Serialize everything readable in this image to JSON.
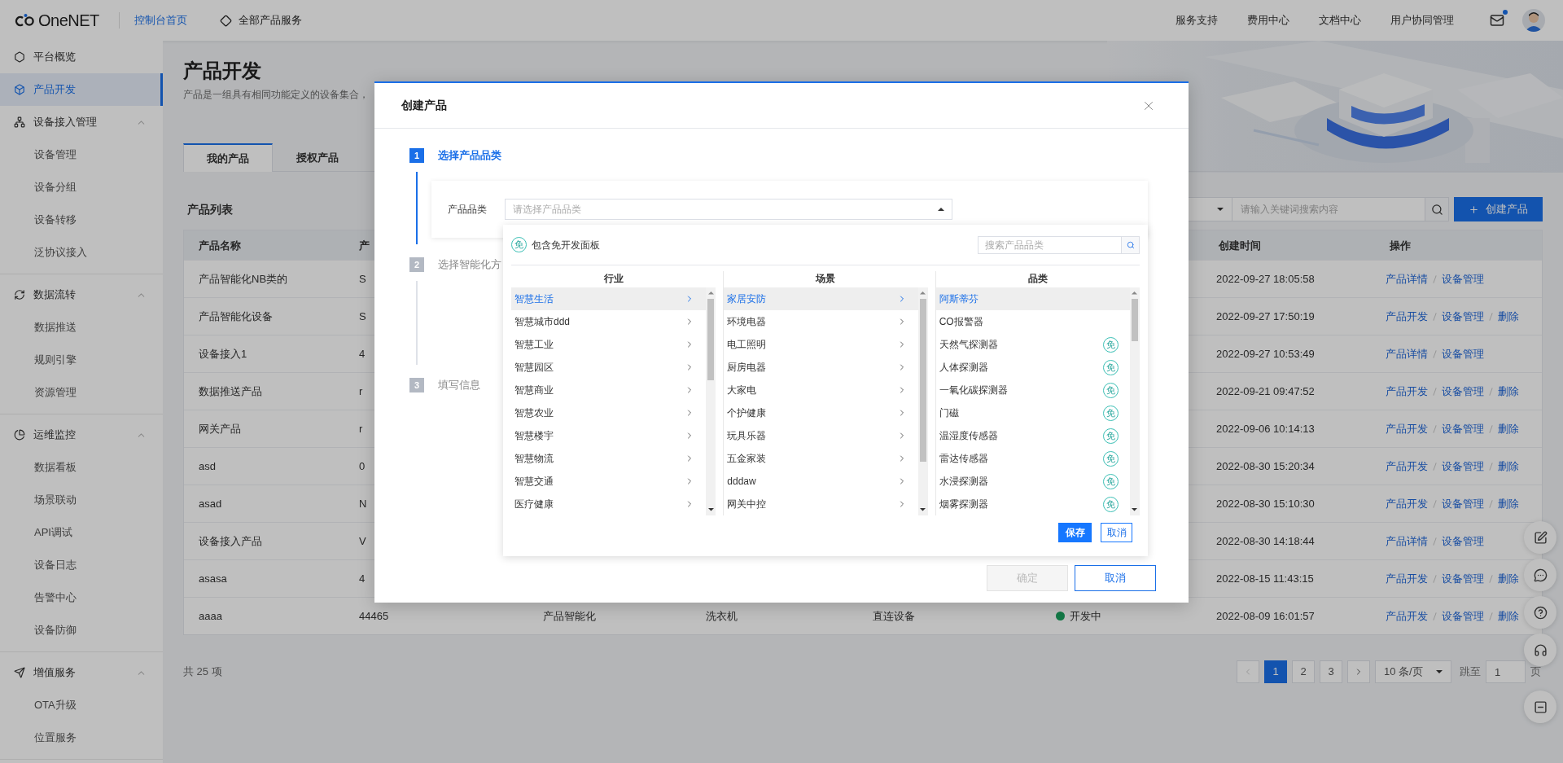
{
  "header": {
    "logo": "OneNET",
    "home_link": {
      "label": "控制台首页",
      "selected": true
    },
    "products_menu": "全部产品服务",
    "links": [
      "服务支持",
      "费用中心",
      "文档中心",
      "用户协同管理"
    ],
    "mail": {
      "unread": true
    }
  },
  "sidebar": {
    "items": [
      {
        "label": "平台概览",
        "selected": false
      },
      {
        "label": "产品开发",
        "selected": true
      },
      {
        "label": "设备接入管理",
        "expanded": true,
        "children": [
          {
            "label": "设备管理",
            "selected": false
          },
          {
            "label": "设备分组",
            "selected": false
          },
          {
            "label": "设备转移",
            "selected": false
          },
          {
            "label": "泛协议接入",
            "selected": false
          }
        ]
      },
      {
        "label": "数据流转",
        "expanded": true,
        "children": [
          {
            "label": "数据推送",
            "selected": false
          },
          {
            "label": "规则引擎",
            "selected": false
          },
          {
            "label": "资源管理",
            "selected": false
          }
        ]
      },
      {
        "label": "运维监控",
        "expanded": true,
        "children": [
          {
            "label": "数据看板",
            "selected": false
          },
          {
            "label": "场景联动",
            "selected": false
          },
          {
            "label": "API调试",
            "selected": false
          },
          {
            "label": "设备日志",
            "selected": false
          },
          {
            "label": "告警中心",
            "selected": false
          },
          {
            "label": "设备防御",
            "selected": false
          }
        ]
      },
      {
        "label": "增值服务",
        "expanded": true,
        "children": [
          {
            "label": "OTA升级",
            "selected": false
          },
          {
            "label": "位置服务",
            "selected": false
          }
        ]
      }
    ]
  },
  "page": {
    "title": "产品开发",
    "subtitle": "产品是一组具有相同功能定义的设备集合，",
    "tabs": [
      {
        "label": "我的产品",
        "selected": true
      },
      {
        "label": "授权产品",
        "selected": false
      }
    ],
    "list_title": "产品列表",
    "search": {
      "placeholder": "请输入关键词搜索内容"
    },
    "create_button": "创建产品"
  },
  "table": {
    "columns": [
      "产品名称",
      "产",
      "创建时间",
      "操作"
    ],
    "rows": [
      {
        "name": "产品智能化NB类的",
        "column_2": "S",
        "created": "2022-09-27 18:05:58",
        "actions": [
          "产品详情",
          "设备管理"
        ]
      },
      {
        "name": "产品智能化设备",
        "column_2": "S",
        "created": "2022-09-27 17:50:19",
        "actions": [
          "产品开发",
          "设备管理",
          "删除"
        ]
      },
      {
        "name": "设备接入1",
        "column_2": "4",
        "created": "2022-09-27 10:53:49",
        "actions": [
          "产品详情",
          "设备管理"
        ]
      },
      {
        "name": "数据推送产品",
        "column_2": "r",
        "created": "2022-09-21 09:47:52",
        "actions": [
          "产品开发",
          "设备管理",
          "删除"
        ]
      },
      {
        "name": "网关产品",
        "column_2": "r",
        "created": "2022-09-06 10:14:13",
        "actions": [
          "产品开发",
          "设备管理",
          "删除"
        ]
      },
      {
        "name": "asd",
        "column_2": "0",
        "created": "2022-08-30 15:20:34",
        "actions": [
          "产品开发",
          "设备管理",
          "删除"
        ]
      },
      {
        "name": "asad",
        "column_2": "N",
        "created": "2022-08-30 15:10:30",
        "actions": [
          "产品开发",
          "设备管理",
          "删除"
        ]
      },
      {
        "name": "设备接入产品",
        "column_2": "V",
        "created": "2022-08-30 14:18:44",
        "actions": [
          "产品详情",
          "设备管理"
        ]
      },
      {
        "name": "asasa",
        "column_2": "4",
        "created": "2022-08-15 11:43:15",
        "actions": [
          "产品开发",
          "设备管理",
          "删除"
        ]
      },
      {
        "name": "aaaa",
        "column_2": "44465",
        "column_3": "产品智能化",
        "column_4": "洗衣机",
        "column_5": "直连设备",
        "status": {
          "label": "开发中",
          "color": "#137947"
        },
        "created": "2022-08-09 16:01:57",
        "actions": [
          "产品开发",
          "设备管理",
          "删除"
        ]
      }
    ]
  },
  "footer": {
    "total": "共 25 项",
    "pagination": {
      "prev_disabled": true,
      "pages": [
        {
          "label": "1",
          "selected": true
        },
        {
          "label": "2",
          "selected": false
        },
        {
          "label": "3",
          "selected": false
        }
      ],
      "page_size": "10 条/页",
      "jump_label": "跳至",
      "jump_value": "1",
      "jump_suffix": "页"
    }
  },
  "modal": {
    "title": "创建产品",
    "steps": [
      {
        "number": "1",
        "label": "选择产品品类",
        "selected": true
      },
      {
        "number": "2",
        "label": "选择智能化方",
        "selected": false
      },
      {
        "number": "3",
        "label": "填写信息",
        "selected": false
      }
    ],
    "field": {
      "label": "产品品类",
      "placeholder": "请选择产品品类",
      "expanded": true
    },
    "dropdown": {
      "free_badge": "免",
      "free_label": "包含免开发面板",
      "search_placeholder": "搜索产品品类",
      "columns": [
        {
          "title": "行业",
          "items": [
            {
              "label": "智慧生活",
              "selected": true
            },
            {
              "label": "智慧城市ddd",
              "selected": false
            },
            {
              "label": "智慧工业",
              "selected": false
            },
            {
              "label": "智慧园区",
              "selected": false
            },
            {
              "label": "智慧商业",
              "selected": false
            },
            {
              "label": "智慧农业",
              "selected": false
            },
            {
              "label": "智慧楼宇",
              "selected": false
            },
            {
              "label": "智慧物流",
              "selected": false
            },
            {
              "label": "智慧交通",
              "selected": false
            },
            {
              "label": "医疗健康",
              "selected": false
            }
          ]
        },
        {
          "title": "场景",
          "items": [
            {
              "label": "家居安防",
              "selected": true
            },
            {
              "label": "环境电器",
              "selected": false
            },
            {
              "label": "电工照明",
              "selected": false
            },
            {
              "label": "厨房电器",
              "selected": false
            },
            {
              "label": "大家电",
              "selected": false
            },
            {
              "label": "个护健康",
              "selected": false
            },
            {
              "label": "玩具乐器",
              "selected": false
            },
            {
              "label": "五金家装",
              "selected": false
            },
            {
              "label": "dddaw",
              "selected": false
            },
            {
              "label": "网关中控",
              "selected": false
            }
          ]
        },
        {
          "title": "品类",
          "items": [
            {
              "label": "阿斯蒂芬",
              "selected": true
            },
            {
              "label": "CO报警器",
              "selected": false
            },
            {
              "label": "天然气探测器",
              "selected": false,
              "badge": "免"
            },
            {
              "label": "人体探测器",
              "selected": false,
              "badge": "免"
            },
            {
              "label": "一氧化碳探测器",
              "selected": false,
              "badge": "免"
            },
            {
              "label": "门磁",
              "selected": false,
              "badge": "免"
            },
            {
              "label": "温湿度传感器",
              "selected": false,
              "badge": "免"
            },
            {
              "label": "雷达传感器",
              "selected": false,
              "badge": "免"
            },
            {
              "label": "水浸探测器",
              "selected": false,
              "badge": "免"
            },
            {
              "label": "烟雾探测器",
              "selected": false,
              "badge": "免"
            }
          ]
        }
      ],
      "save_button": "保存",
      "cancel_button": "取消"
    },
    "confirm_button": {
      "label": "确定",
      "disabled": true
    },
    "cancel_button": "取消"
  }
}
